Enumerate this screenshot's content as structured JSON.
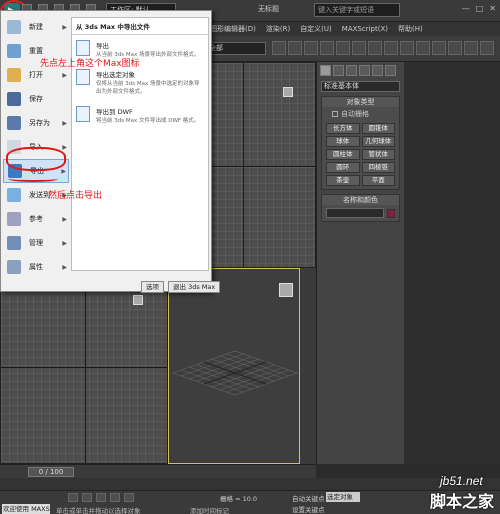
{
  "titlebar": {
    "workspace": "工作区: 默认",
    "window_title": "无标题",
    "search_placeholder": "键入关键字或短语",
    "controls": [
      "—",
      "□",
      "✕"
    ]
  },
  "menubar": [
    "图形编辑器(D)",
    "渲染(R)",
    "自定义(U)",
    "MAXScript(X)",
    "帮助(H)"
  ],
  "toolbar": {
    "selection_dropdown": "全部"
  },
  "app_menu": {
    "left_items": [
      {
        "label": "新建"
      },
      {
        "label": "重置"
      },
      {
        "label": "打开"
      },
      {
        "label": "保存"
      },
      {
        "label": "另存为"
      },
      {
        "label": "导入"
      },
      {
        "label": "导出"
      },
      {
        "label": "发送到"
      },
      {
        "label": "参考"
      },
      {
        "label": "管理"
      },
      {
        "label": "属性"
      }
    ],
    "right_header": "从 3ds Max 中导出文件",
    "entries": [
      {
        "title": "导出",
        "desc": "从当前 3ds Max 场景导出外部文件格式。"
      },
      {
        "title": "导出选定对象",
        "desc": "仅将从当前 3ds Max 场景中选定的对象导出为外部文件格式。"
      },
      {
        "title": "导出到 DWF",
        "desc": "将当前 3ds Max 文件导出成 DWF 格式。"
      }
    ],
    "options_button": "选项",
    "exit_button": "退出 3ds Max"
  },
  "command_panel": {
    "category_dropdown": "标准基本体",
    "object_type_header": "对象类型",
    "autogrid_label": "自动栅格",
    "objects": [
      "长方体",
      "圆锥体",
      "球体",
      "几何球体",
      "圆柱体",
      "管状体",
      "圆环",
      "四棱锥",
      "茶壶",
      "平面"
    ],
    "name_color_header": "名称和颜色",
    "color_swatch": "#8a1e3e"
  },
  "timeline": {
    "frame": "0 / 100"
  },
  "statusbar": {
    "welcome": "欢迎使用 MAXSc",
    "prompt": "单击或单击并拖动以选择对象",
    "grid": "栅格 = 10.0",
    "autokey": "自动关键点",
    "set_key": "设置关键点",
    "add_time": "添加时间标记",
    "selected_object": "选定对象"
  },
  "annotations": {
    "step1": "先点左上角这个Max图标",
    "step2": "然后点击导出"
  },
  "watermark": {
    "line1": "jb51.net",
    "line2": "脚本之家"
  }
}
